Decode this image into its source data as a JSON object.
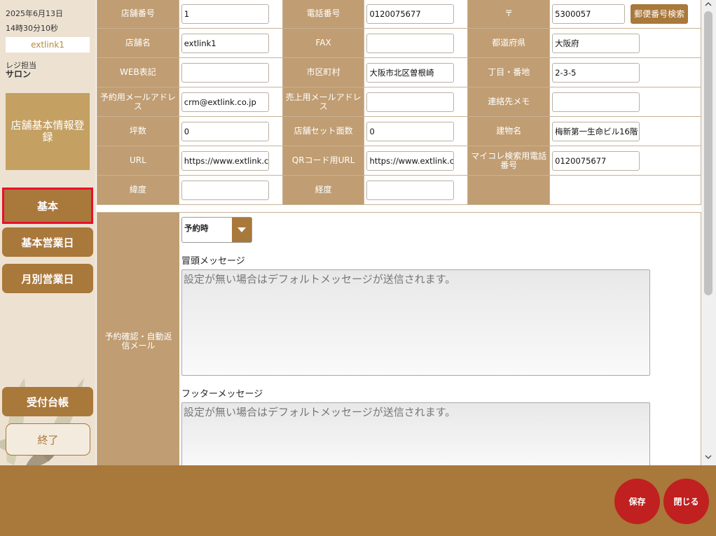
{
  "sidebar": {
    "date": "2025年6月13日",
    "time": "14時30分10秒",
    "store": "extlink1",
    "staff_label": "レジ担当",
    "staff_name": "サロン",
    "page_title": "店舗基本情報登録",
    "nav": {
      "basic": "基本",
      "basic_business_days": "基本営業日",
      "monthly_business_days": "月別営業日",
      "reception_ledger": "受付台帳",
      "exit": "終了"
    }
  },
  "form": {
    "labels": {
      "store_number": "店舗番号",
      "phone": "電話番号",
      "postal_mark": "〒",
      "store_name": "店舗名",
      "fax": "FAX",
      "prefecture": "都道府県",
      "web_notation": "WEB表記",
      "city": "市区町村",
      "address_block": "丁目・番地",
      "reservation_email": "予約用メールアドレス",
      "sales_email": "売上用メールアドレス",
      "contact_memo": "連絡先メモ",
      "floor_area": "坪数",
      "seat_count": "店舗セット面数",
      "building": "建物名",
      "url": "URL",
      "qr_url": "QRコード用URL",
      "mycolle_phone": "マイコレ検索用電話番号",
      "latitude": "緯度",
      "longitude": "経度"
    },
    "values": {
      "store_number": "1",
      "phone": "0120075677",
      "postal_code": "5300057",
      "store_name": "extlink1",
      "fax": "",
      "prefecture": "大阪府",
      "web_notation": "",
      "city": "大阪市北区曽根崎",
      "address_block": "2-3-5",
      "reservation_email": "crm@extlink.co.jp",
      "sales_email": "",
      "contact_memo": "",
      "floor_area": "0",
      "seat_count": "0",
      "building": "梅新第一生命ビル16階",
      "url": "https://www.extlink.co.jp",
      "qr_url": "https://www.extlink.co.jp",
      "mycolle_phone": "0120075677",
      "latitude": "",
      "longitude": ""
    },
    "postal_search_button": "郵便番号検索"
  },
  "mail": {
    "section_label": "予約確認・自動返信メール",
    "select_value": "予約時",
    "header_message_title": "冒頭メッセージ",
    "header_message_placeholder": "設定が無い場合はデフォルトメッセージが送信されます。",
    "footer_message_title": "フッターメッセージ",
    "footer_message_placeholder": "設定が無い場合はデフォルトメッセージが送信されます。"
  },
  "footer": {
    "save": "保存",
    "close": "閉じる"
  },
  "colors": {
    "accent_brown": "#a9783b",
    "label_tan": "#c09d72",
    "sidebar_bg": "#ede2d2",
    "round_button_red": "#c0201f",
    "active_outline": "#e8102a"
  }
}
